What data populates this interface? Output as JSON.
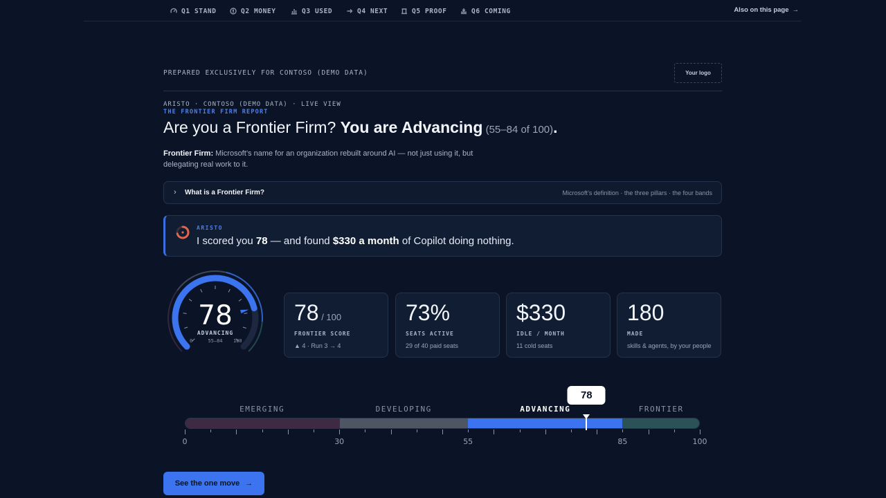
{
  "nav": {
    "items": [
      {
        "label": "Q1 STAND",
        "icon": "gauge-icon"
      },
      {
        "label": "Q2 MONEY",
        "icon": "coin-icon"
      },
      {
        "label": "Q3 USED",
        "icon": "bar-chart-icon"
      },
      {
        "label": "Q4 NEXT",
        "icon": "arrow-right-icon"
      },
      {
        "label": "Q5 PROOF",
        "icon": "pillar-icon"
      },
      {
        "label": "Q6 COMING",
        "icon": "stack-icon"
      }
    ],
    "also_label": "Also on this page"
  },
  "prepared": "PREPARED EXCLUSIVELY FOR CONTOSO (DEMO DATA)",
  "logo_placeholder": "Your logo",
  "kicker": "ARISTO · CONTOSO (DEMO DATA) · LIVE VIEW",
  "report_title": "THE FRONTIER FIRM REPORT",
  "headline": {
    "lead": "Are you a Frontier Firm? ",
    "strong": "You are Advancing",
    "range": " (55–84 of 100)",
    "end": "."
  },
  "definition": {
    "term": "Frontier Firm:",
    "text": " Microsoft’s name for an organization rebuilt around AI — not just using it, but delegating real work to it."
  },
  "accordion": {
    "label": "What is a Frontier Firm?",
    "meta": "Microsoft’s definition · the three pillars · the four bands"
  },
  "callout": {
    "who": "ARISTO",
    "q1": "I scored you ",
    "q_score": "78",
    "q2": " — and found ",
    "q_money": "$330 a month",
    "q3": " of Copilot doing nothing."
  },
  "gauge": {
    "value": 78,
    "max": 100,
    "score_text": "78",
    "band": "ADVANCING",
    "band_range": "55–84",
    "min_label": "0",
    "max_label": "100"
  },
  "cards": [
    {
      "big": "78",
      "of": " / 100",
      "label": "FRONTIER SCORE",
      "sub": "▲ 4 · Run 3 → 4"
    },
    {
      "big": "73%",
      "of": "",
      "label": "SEATS ACTIVE",
      "sub": "29 of 40 paid seats"
    },
    {
      "big": "$330",
      "of": "",
      "label": "IDLE / MONTH",
      "sub": "11 cold seats"
    },
    {
      "big": "180",
      "of": "",
      "label": "MADE",
      "sub": "skills & agents, by your people"
    }
  ],
  "scale": {
    "score": 78,
    "score_text": "78",
    "bands": [
      {
        "label": "EMERGING",
        "from": 0,
        "to": 30,
        "color": "#3f2a44"
      },
      {
        "label": "DEVELOPING",
        "from": 30,
        "to": 55,
        "color": "#4e5563"
      },
      {
        "label": "ADVANCING",
        "from": 55,
        "to": 85,
        "color": "#3b74ee",
        "active": true
      },
      {
        "label": "FRONTIER",
        "from": 85,
        "to": 100,
        "color": "#2a5257"
      }
    ],
    "tick_labels": [
      "0",
      "30",
      "55",
      "85",
      "100"
    ]
  },
  "cta": {
    "label": "See the one move"
  },
  "colors": {
    "accent": "#3b74ee",
    "background": "#0b1426",
    "card": "#111d33"
  }
}
